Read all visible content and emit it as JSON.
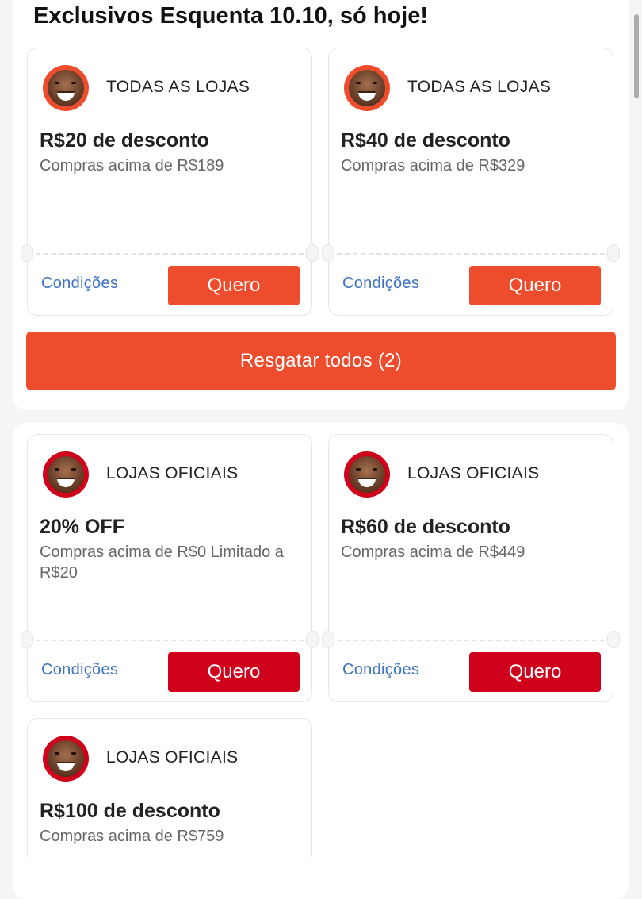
{
  "page": {
    "title": "Exclusivos Esquenta 10.10, só hoje!",
    "claim_all_label": "Resgatar todos (2)"
  },
  "colors": {
    "shopee_orange": "#ee4d2d",
    "official_red": "#d0011b",
    "link_blue": "#3e72c4"
  },
  "coupons": [
    {
      "store": "TODAS AS LOJAS",
      "discount": "R$20 de desconto",
      "condition": "Compras acima de R$189",
      "conditions_link": "Condições",
      "cta": "Quero"
    },
    {
      "store": "TODAS AS LOJAS",
      "discount": "R$40 de desconto",
      "condition": "Compras acima de R$329",
      "conditions_link": "Condições",
      "cta": "Quero"
    },
    {
      "store": "LOJAS OFICIAIS",
      "discount": "20% OFF",
      "condition": "Compras acima de R$0 Limitado a R$20",
      "conditions_link": "Condições",
      "cta": "Quero"
    },
    {
      "store": "LOJAS OFICIAIS",
      "discount": "R$60 de desconto",
      "condition": "Compras acima de R$449",
      "conditions_link": "Condições",
      "cta": "Quero"
    },
    {
      "store": "LOJAS OFICIAIS",
      "discount": "R$100 de desconto",
      "condition": "Compras acima de R$759"
    }
  ]
}
